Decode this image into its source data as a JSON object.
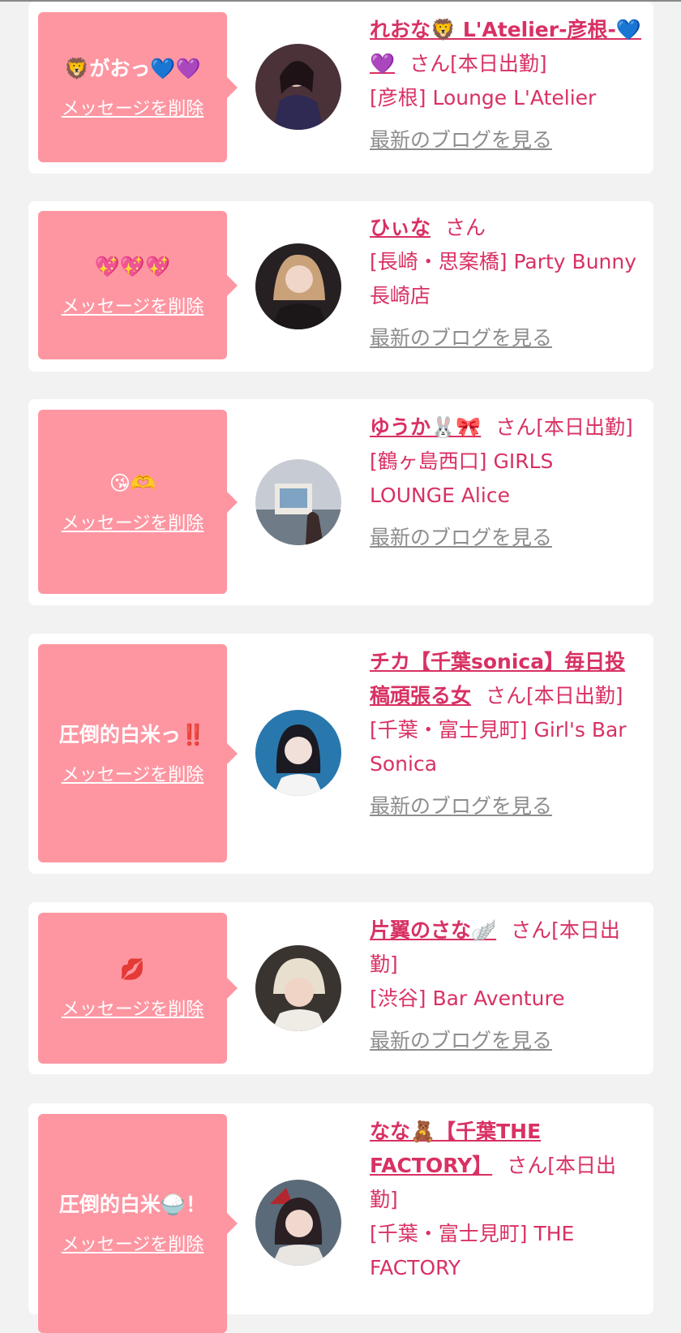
{
  "entries": [
    {
      "message": "🦁がおっ💙💜",
      "delete_label": "メッセージを削除",
      "name": "れおな🦁 L'Atelier-彦根-💙💜",
      "honorific": "さん[本日出勤]",
      "shop": "[彦根] Lounge L'Atelier",
      "blog_label": "最新のブログを見る"
    },
    {
      "message": "💖💖💖",
      "delete_label": "メッセージを削除",
      "name": "ひぃな",
      "honorific": "さん",
      "shop": "[長崎・思案橋] Party Bunny 長崎店",
      "blog_label": "最新のブログを見る"
    },
    {
      "message": "😘🫶",
      "delete_label": "メッセージを削除",
      "name": "ゆうか🐰🎀",
      "honorific": "さん[本日出勤]",
      "shop": "[鶴ヶ島西口] GIRLS LOUNGE Alice",
      "blog_label": "最新のブログを見る"
    },
    {
      "message": "圧倒的白米っ‼️",
      "delete_label": "メッセージを削除",
      "name": "チカ【千葉sonica】毎日投稿頑張る女",
      "honorific": "さん[本日出勤]",
      "shop": "[千葉・富士見町] Girl's Bar Sonica",
      "blog_label": "最新のブログを見る"
    },
    {
      "message": "💋",
      "delete_label": "メッセージを削除",
      "name": "片翼のさな🪽",
      "honorific": "さん[本日出勤]",
      "shop": "[渋谷] Bar Aventure",
      "blog_label": "最新のブログを見る"
    },
    {
      "message": "圧倒的白米🍚！",
      "delete_label": "メッセージを削除",
      "name": "なな🧸【千葉THE FACTORY】",
      "honorific": "さん[本日出勤]",
      "shop": "[千葉・富士見町] THE FACTORY",
      "blog_label": ""
    }
  ],
  "colors": {
    "bubble": "#fe96a2",
    "accent_text": "#d83163",
    "muted_link": "#8d8d8d",
    "page_bg": "#f2f2f2"
  }
}
